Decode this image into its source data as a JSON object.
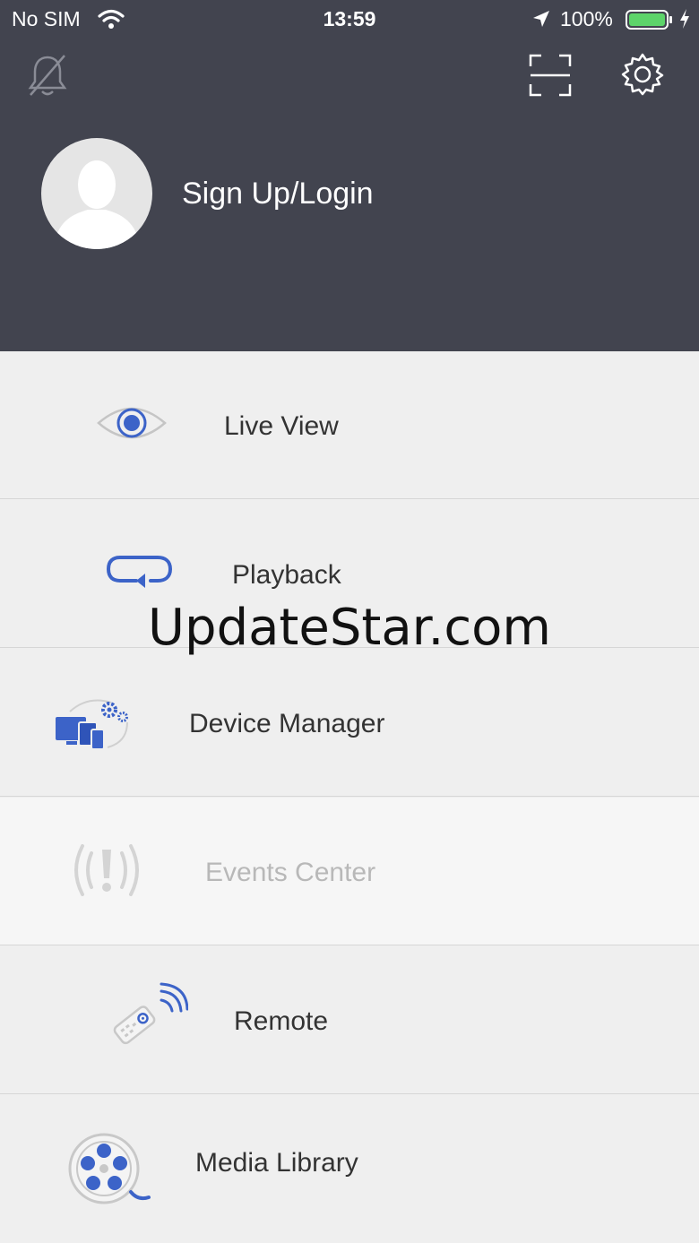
{
  "status_bar": {
    "carrier": "No SIM",
    "time": "13:59",
    "battery_pct": "100%"
  },
  "header": {
    "icons": [
      "bell-off-icon",
      "scan-icon",
      "gear-icon"
    ],
    "login_label": "Sign Up/Login"
  },
  "menu": {
    "items": [
      {
        "label": "Live View",
        "icon": "eye-icon",
        "enabled": true
      },
      {
        "label": "Playback",
        "icon": "replay-icon",
        "enabled": true
      },
      {
        "label": "Device Manager",
        "icon": "devices-gear-icon",
        "enabled": true
      },
      {
        "label": "Events Center",
        "icon": "alert-signal-icon",
        "enabled": false
      },
      {
        "label": "Remote",
        "icon": "remote-control-icon",
        "enabled": true
      },
      {
        "label": "Media Library",
        "icon": "film-reel-icon",
        "enabled": true
      }
    ]
  },
  "watermark": "UpdateStar.com",
  "colors": {
    "header_bg": "#42444f",
    "accent": "#3c63c8",
    "menu_bg": "#efefef",
    "disabled_text": "#b8b8b8"
  }
}
